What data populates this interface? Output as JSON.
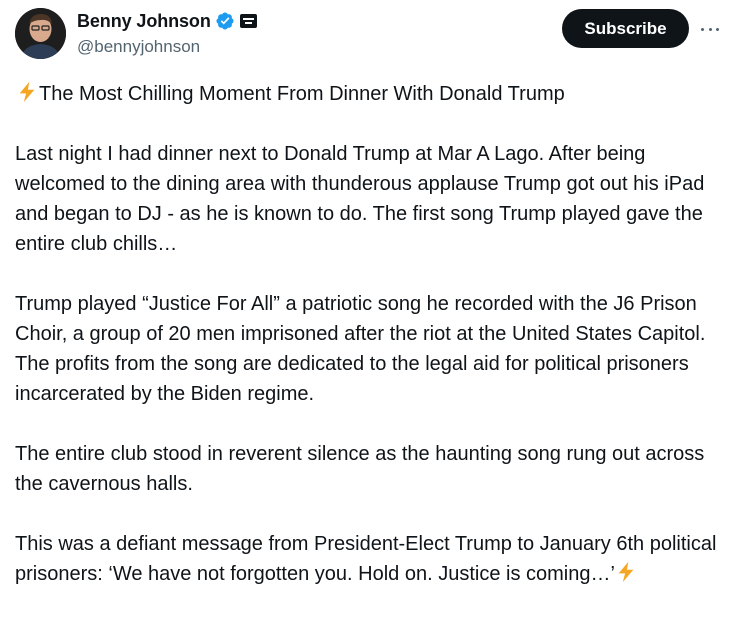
{
  "author": {
    "display_name": "Benny Johnson",
    "handle": "@bennyjohnson",
    "verified_icon": "verified-checkmark-icon",
    "affiliation_icon": "affiliation-badge-icon"
  },
  "actions": {
    "subscribe_label": "Subscribe",
    "more_icon": "more-options-icon"
  },
  "colors": {
    "text": "#0f1419",
    "secondary_text": "#536471",
    "verified_blue": "#1d9bf0",
    "bolt_yellow": "#f5a623"
  },
  "tweet": {
    "title_emoji": "high-voltage-emoji",
    "title": "The Most Chilling Moment From Dinner With Donald Trump",
    "paragraphs": [
      "Last night I had dinner next to Donald Trump at Mar A Lago. After being welcomed to the dining area with thunderous applause Trump got out his iPad and began to DJ - as he is known to do. The first song Trump played gave the entire club chills…",
      "Trump played “Justice For All” a patriotic song he recorded with the J6 Prison Choir, a group of 20 men imprisoned after the riot at the United States Capitol. The profits from the song are dedicated to the legal aid for political prisoners incarcerated by the Biden regime.",
      "The entire club stood in reverent silence as the haunting song rung out across the cavernous halls.",
      "This was a defiant message from President-Elect Trump to January 6th political prisoners: ‘We have not forgotten you. Hold on. Justice is coming…’"
    ],
    "closing_emoji": "high-voltage-emoji"
  }
}
